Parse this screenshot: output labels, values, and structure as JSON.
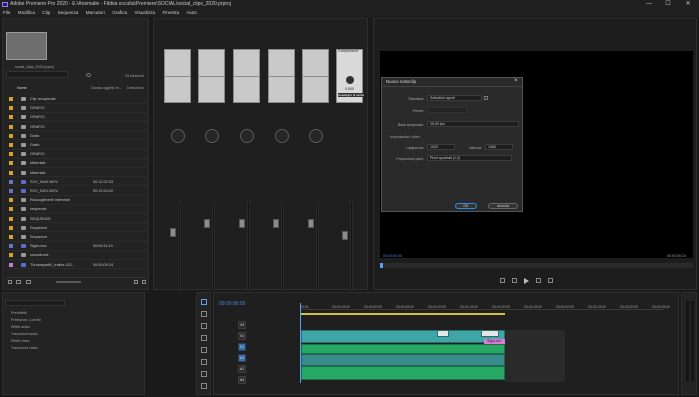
{
  "titlebar": {
    "title": "Adobe Premiere Pro 2020 - E:\\Anomalie - Fibbia occulta\\Premiere\\SOCIAL\\social_clips_2020.prproj",
    "minimize": "—",
    "maximize": "☐",
    "close": "✕"
  },
  "menu": [
    "File",
    "Modifica",
    "Clip",
    "Sequenza",
    "Marcatori",
    "Grafica",
    "Visualizza",
    "Finestra",
    "Aiuto"
  ],
  "project": {
    "filename": "social_clips_2020.prproj",
    "items_count": "23 elementi",
    "col_name": "Nome",
    "col_duration": "Durata oggetto m...",
    "col_desc": "Descrizion",
    "rows": [
      {
        "name": "Clip recuperate",
        "dur": "",
        "color": "#d8a22a",
        "kind": "folder"
      },
      {
        "name": "GRAFIO",
        "dur": "",
        "color": "#d8a22a",
        "kind": "folder"
      },
      {
        "name": "GRAFIO",
        "dur": "",
        "color": "#d8a22a",
        "kind": "folder"
      },
      {
        "name": "GRAFIO",
        "dur": "",
        "color": "#d8a22a",
        "kind": "folder"
      },
      {
        "name": "Grafo",
        "dur": "",
        "color": "#d8a22a",
        "kind": "folder"
      },
      {
        "name": "Grafo",
        "dur": "",
        "color": "#d8a22a",
        "kind": "folder"
      },
      {
        "name": "GRAFIO",
        "dur": "",
        "color": "#d8a22a",
        "kind": "folder"
      },
      {
        "name": "Materiale",
        "dur": "",
        "color": "#d8a22a",
        "kind": "folder"
      },
      {
        "name": "Materiale",
        "dur": "",
        "color": "#d8a22a",
        "kind": "folder"
      },
      {
        "name": "SVV_9440.MOV",
        "dur": "00:12:22:03",
        "color": "#6a72c8",
        "kind": "clip"
      },
      {
        "name": "SVV_9421.MOV",
        "dur": "00:12:24:02",
        "color": "#6a72c8",
        "kind": "clip"
      },
      {
        "name": "Raccoglimenti interviste",
        "dur": "",
        "color": "#d8a22a",
        "kind": "folder"
      },
      {
        "name": "sequenze",
        "dur": "",
        "color": "#d8a22a",
        "kind": "folder"
      },
      {
        "name": "SEQUENZE",
        "dur": "",
        "color": "#d8a22a",
        "kind": "folder"
      },
      {
        "name": "Sequenze",
        "dur": "",
        "color": "#d8a22a",
        "kind": "folder"
      },
      {
        "name": "Sequenze",
        "dur": "",
        "color": "#d8a22a",
        "kind": "folder"
      },
      {
        "name": "Sigla.mov",
        "dur": "00:00:11:10",
        "color": "#6a72c8",
        "kind": "clip"
      },
      {
        "name": "soundtrack",
        "dur": "",
        "color": "#d8a22a",
        "kind": "folder"
      },
      {
        "name": "Throwaparti0_trailes-421...",
        "dur": "00:00:09:24",
        "color": "#c87ac8",
        "kind": "clip"
      }
    ]
  },
  "mixer": {
    "master_label": "Compressore",
    "readout": "0,000",
    "readout2": "Guadagno di uscita"
  },
  "program": {
    "timecode_left": "00:00:00:00",
    "timecode_right": "00:00:00:24"
  },
  "dialog": {
    "title": "Nuovo sottoclip",
    "close": "×",
    "standard_label": "Standard:",
    "standard_value": "Sottotitoli aperti",
    "preset_label": "Preset:",
    "flusso_label": "Base temporale:",
    "flusso_value": "25,00 fps",
    "section_label": "Impostazioni video",
    "width_label": "Larghezza:",
    "width_value": "1920",
    "height_label": "Altezza:",
    "height_value": "1080",
    "pixel_label": "Proporzioni pixel:",
    "pixel_value": "Pixel quadrati (1,0)",
    "ok": "OK",
    "cancel": "Annulla"
  },
  "effects": {
    "items": [
      "Predefiniti",
      "Preimpost. Lumetri",
      "Effetti audio",
      "Transizioni audio",
      "Effetti video",
      "Transizioni video"
    ]
  },
  "timeline": {
    "timecode": "00:00:00:00",
    "ruler": [
      "00:00",
      "00:00:15:00",
      "00:00:30:00",
      "00:00:45:00",
      "00:01:00:00",
      "00:01:15:00",
      "00:01:30:00",
      "00:01:45:00",
      "00:02:00:00",
      "00:02:15:00",
      "00:02:30:00",
      "00:02:45:00"
    ],
    "track_labels": [
      "V3",
      "V2",
      "V1",
      "A1",
      "A2",
      "A3"
    ],
    "clip_title": "Sigla.mo"
  },
  "colors": {
    "bg": "#1a1a1a",
    "panel": "#232323",
    "video_clip": "#3ea6a6",
    "audio_clip": "#26a864",
    "playhead": "#5aa0ff",
    "accent": "#2d8ceb",
    "pink_clip": "#e07ad8"
  }
}
